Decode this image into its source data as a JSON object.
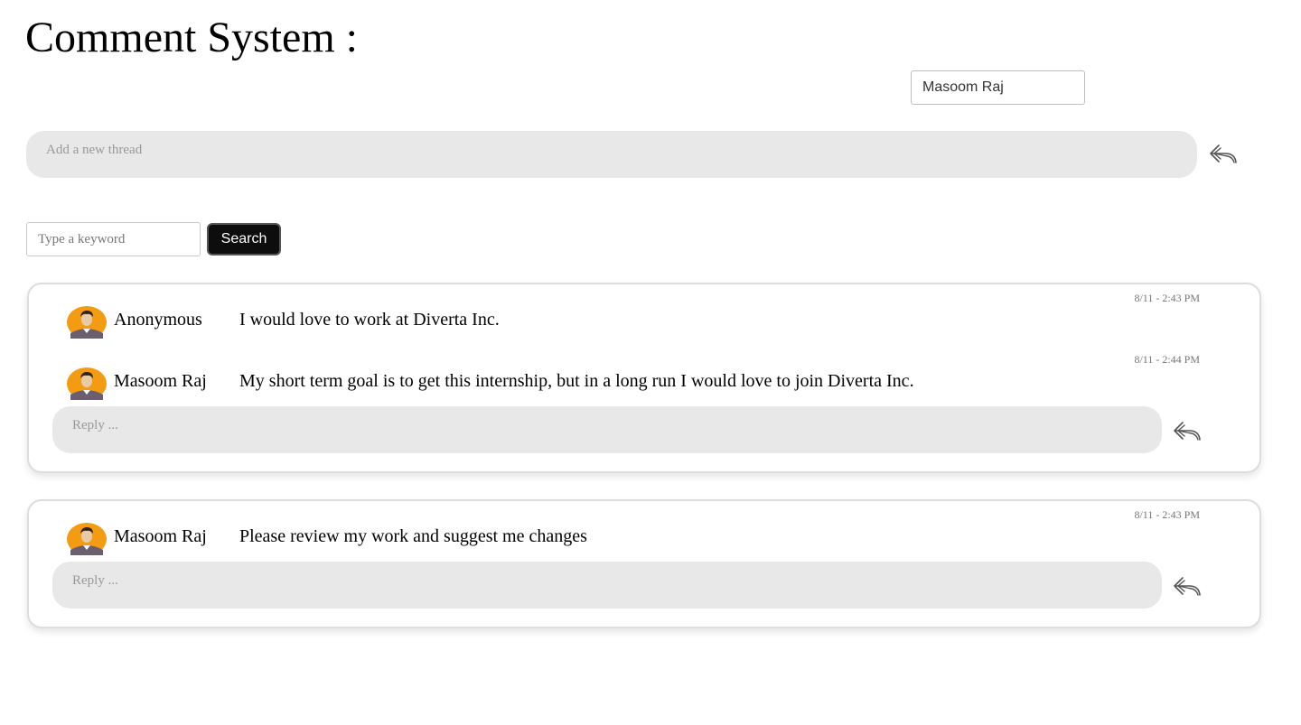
{
  "header": {
    "title": "Comment System :",
    "current_user": "Masoom Raj"
  },
  "new_thread": {
    "placeholder": "Add a new thread",
    "send_icon": "reply-arrow-icon"
  },
  "search": {
    "placeholder": "Type a keyword",
    "button_label": "Search"
  },
  "threads": [
    {
      "comments": [
        {
          "author": "Anonymous",
          "text": "I would love to work at Diverta Inc.",
          "timestamp": "8/11 - 2:43 PM"
        },
        {
          "author": "Masoom Raj",
          "text": "My short term goal is to get this internship, but in a long run I would love to join Diverta Inc.",
          "timestamp": "8/11 - 2:44 PM"
        }
      ],
      "reply_placeholder": "Reply ..."
    },
    {
      "comments": [
        {
          "author": "Masoom Raj",
          "text": "Please review my work and suggest me changes",
          "timestamp": "8/11 - 2:43 PM"
        }
      ],
      "reply_placeholder": "Reply ..."
    }
  ],
  "colors": {
    "input_fill": "#e8e8e8",
    "button_fill": "#0d0d0d",
    "card_border": "#dddddd",
    "avatar_bg": "#f39c12"
  }
}
